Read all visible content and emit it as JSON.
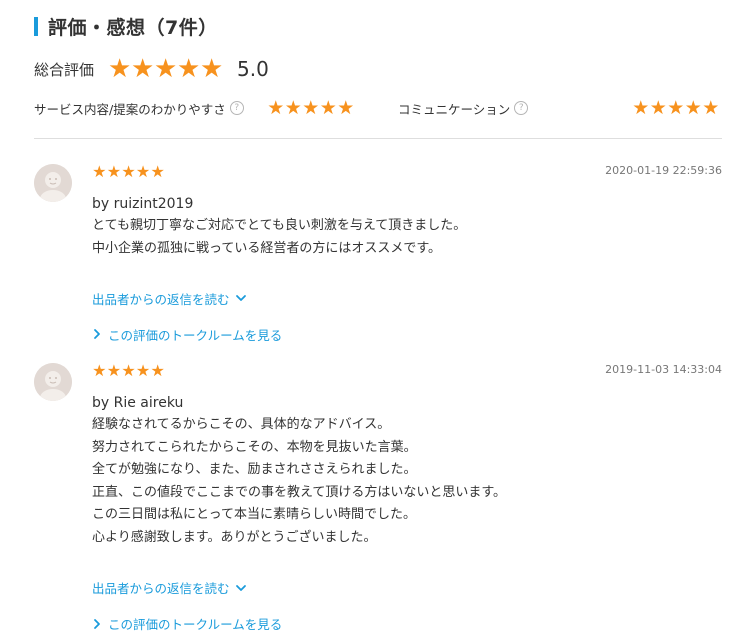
{
  "section": {
    "title": "評価・感想（7件）",
    "accent_color": "#1a9bdb",
    "star_color": "#f7921e"
  },
  "overall": {
    "label": "総合評価",
    "stars": 5,
    "score": "5.0"
  },
  "categories": [
    {
      "label": "サービス内容/提案のわかりやすさ",
      "help": "?",
      "stars": 5
    },
    {
      "label": "コミュニケーション",
      "help": "?",
      "stars": 5
    }
  ],
  "reviews": [
    {
      "stars": 5,
      "date": "2020-01-19 22:59:36",
      "user": "by ruizint2019",
      "lines": [
        "とても親切丁寧なご対応でとても良い刺激を与えて頂きました。",
        "中小企業の孤独に戦っている経営者の方にはオススメです。"
      ],
      "reply_link": "出品者からの返信を読む",
      "talk_link": "この評価のトークルームを見る"
    },
    {
      "stars": 5,
      "date": "2019-11-03 14:33:04",
      "user": "by Rie aireku",
      "lines": [
        "経験なされてるからこその、具体的なアドバイス。",
        "努力されてこられたからこその、本物を見抜いた言葉。",
        "全てが勉強になり、また、励まされささえられました。",
        "正直、この値段でここまでの事を教えて頂ける方はいないと思います。",
        "この三日間は私にとって本当に素晴らしい時間でした。",
        "心より感謝致します。ありがとうございました。"
      ],
      "reply_link": "出品者からの返信を読む",
      "talk_link": "この評価のトークルームを見る"
    }
  ]
}
